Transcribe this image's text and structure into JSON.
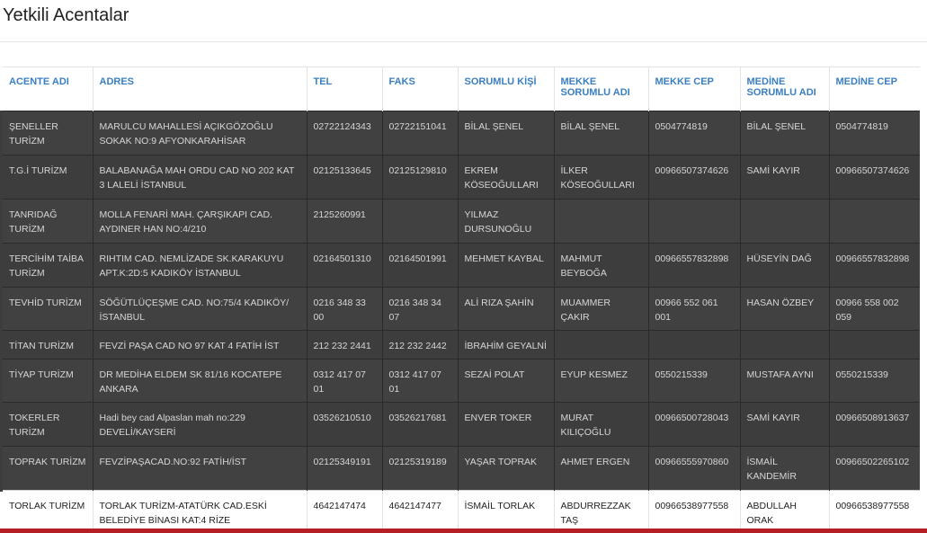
{
  "page": {
    "title": "Yetkili Acentalar"
  },
  "table": {
    "headers": [
      "ACENTE ADI",
      "ADRES",
      "TEL",
      "FAKS",
      "SORUMLU KİŞİ",
      "MEKKE SORUMLU ADI",
      "MEKKE CEP",
      "MEDİNE SORUMLU ADI",
      "MEDİNE CEP"
    ],
    "rows": [
      [
        "ŞENELLER TURİZM",
        "MARULCU MAHALLESİ AÇIKGÖZOĞLU SOKAK NO:9 AFYONKARAHİSAR",
        "02722124343",
        "02722151041",
        "BİLAL ŞENEL",
        "BİLAL ŞENEL",
        "0504774819",
        "BİLAL ŞENEL",
        "0504774819"
      ],
      [
        "T.G.İ TURİZM",
        "BALABANAĞA MAH ORDU CAD NO 202 KAT 3 LALELİ İSTANBUL",
        "02125133645",
        "02125129810",
        "EKREM KÖSEOĞULLARI",
        "İLKER KÖSEOĞULLARI",
        "00966507374626",
        "SAMİ KAYIR",
        "00966507374626"
      ],
      [
        "TANRIDAĞ TURİZM",
        "MOLLA FENARİ MAH. ÇARŞIKAPI CAD. AYDINER HAN NO:4/210",
        "2125260991",
        "",
        "YILMAZ DURSUNOĞLU",
        "",
        "",
        "",
        ""
      ],
      [
        "TERCİHİM TAİBA TURİZM",
        "RIHTIM CAD. NEMLİZADE SK.KARAKUYU APT.K:2D:5 KADIKÖY İSTANBUL",
        "02164501310",
        "02164501991",
        "MEHMET KAYBAL",
        "MAHMUT BEYBOĞA",
        "00966557832898",
        "HÜSEYİN DAĞ",
        "00966557832898"
      ],
      [
        "TEVHİD TURİZM",
        "SÖĞÜTLÜÇEŞME CAD. NO:75/4 KADIKÖY/İSTANBUL",
        "0216 348 33 00",
        "0216 348 34 07",
        "ALİ RIZA ŞAHİN",
        "MUAMMER ÇAKIR",
        "00966 552 061 001",
        "HASAN ÖZBEY",
        "00966 558 002 059"
      ],
      [
        "TİTAN TURİZM",
        "FEVZİ PAŞA CAD NO 97 KAT 4 FATİH İST",
        "212 232 2441",
        "212 232 2442",
        "İBRAHİM GEYALNİ",
        "",
        "",
        "",
        ""
      ],
      [
        "TİYAP TURİZM",
        "DR MEDİHA ELDEM SK 81/16 KOCATEPE ANKARA",
        "0312 417 07 01",
        "0312 417 07 01",
        "SEZAİ POLAT",
        "EYUP KESMEZ",
        "0550215339",
        "MUSTAFA AYNI",
        "0550215339"
      ],
      [
        "TOKERLER TURİZM",
        "Hadi bey cad Alpaslan mah no:229 DEVELİ/KAYSERİ",
        "03526210510",
        "03526217681",
        "ENVER TOKER",
        "MURAT KILIÇOĞLU",
        "00966500728043",
        "SAMİ KAYIR",
        "00966508913637"
      ],
      [
        "TOPRAK TURİZM",
        "FEVZİPAŞACAD.NO:92 FATİH/İST",
        "02125349191",
        "02125319189",
        "YAŞAR TOPRAK",
        "AHMET ERGEN",
        "00966555970860",
        "İSMAİL KANDEMİR",
        "00966502265102"
      ],
      [
        "TORLAK TURİZM",
        "TORLAK TURİZM-ATATÜRK CAD.ESKİ BELEDİYE BİNASI KAT:4 RİZE",
        "4642147474",
        "4642147477",
        "İSMAİL TORLAK",
        "ABDURREZZAK TAŞ",
        "00966538977558",
        "ABDULLAH ORAK",
        "00966538977558"
      ]
    ],
    "highlighted_row": 9
  },
  "colors": {
    "header_text": "#3a7fc1",
    "overlay": "#3d3d3d",
    "accent_bar": "#b31f24"
  }
}
